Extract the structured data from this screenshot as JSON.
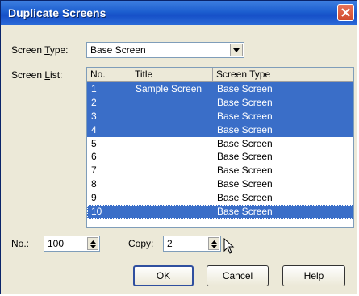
{
  "dialog": {
    "title": "Duplicate Screens"
  },
  "screen_type": {
    "label_prefix": "Screen ",
    "label_mnemonic": "T",
    "label_suffix": "ype:",
    "value": "Base Screen"
  },
  "screen_list": {
    "label_prefix": "Screen ",
    "label_mnemonic": "L",
    "label_suffix": "ist:",
    "columns": [
      "No.",
      "Title",
      "Screen Type"
    ],
    "rows": [
      {
        "no": "1",
        "title": "Sample Screen",
        "type": "Base Screen",
        "selected": true
      },
      {
        "no": "2",
        "title": "",
        "type": "Base Screen",
        "selected": true
      },
      {
        "no": "3",
        "title": "",
        "type": "Base Screen",
        "selected": true
      },
      {
        "no": "4",
        "title": "",
        "type": "Base Screen",
        "selected": true
      },
      {
        "no": "5",
        "title": "",
        "type": "Base Screen",
        "selected": false
      },
      {
        "no": "6",
        "title": "",
        "type": "Base Screen",
        "selected": false
      },
      {
        "no": "7",
        "title": "",
        "type": "Base Screen",
        "selected": false
      },
      {
        "no": "8",
        "title": "",
        "type": "Base Screen",
        "selected": false
      },
      {
        "no": "9",
        "title": "",
        "type": "Base Screen",
        "selected": false
      },
      {
        "no": "10",
        "title": "",
        "type": "Base Screen",
        "selected": true
      }
    ]
  },
  "no_field": {
    "label_mnemonic": "N",
    "label_suffix": "o.:",
    "value": "100"
  },
  "copy_field": {
    "label_mnemonic": "C",
    "label_suffix": "opy:",
    "value": "2"
  },
  "buttons": {
    "ok": "OK",
    "cancel": "Cancel",
    "help": "Help"
  },
  "colors": {
    "selection": "#3a6ec8",
    "title_bar": "#1d5fd0",
    "close_button": "#d04a2c"
  }
}
